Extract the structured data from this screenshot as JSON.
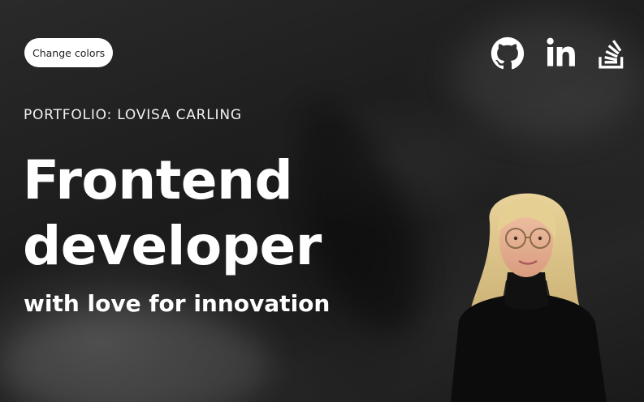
{
  "header": {
    "change_colors_label": "Change colors",
    "social_links": [
      {
        "icon": "github-icon"
      },
      {
        "icon": "linkedin-icon"
      },
      {
        "icon": "stack-overflow-icon"
      }
    ]
  },
  "hero": {
    "eyebrow": "PORTFOLIO: LOVISA CARLING",
    "headline_line1": "Frontend",
    "headline_line2": "developer",
    "subline": "with love for innovation"
  },
  "colors": {
    "background": "#1d1d1d",
    "text": "#ffffff",
    "button_bg": "#ffffff",
    "button_text": "#222222"
  }
}
